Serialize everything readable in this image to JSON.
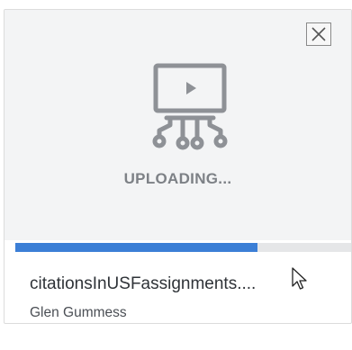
{
  "upload_card": {
    "status_text": "UPLOADING...",
    "file_name": "citationsInUSFassignments....",
    "owner_name": "Glen Gummess",
    "progress_fraction": 0.72,
    "icons": {
      "close": "close-icon",
      "media": "video-file-icon",
      "cursor": "mouse-pointer-icon"
    }
  },
  "colors": {
    "progress_fill": "#3c7fd6",
    "progress_track": "#e5e6e8",
    "icon_gray": "#8e9196",
    "status_text": "#7d8186",
    "preview_bg": "#f3f4f5"
  }
}
